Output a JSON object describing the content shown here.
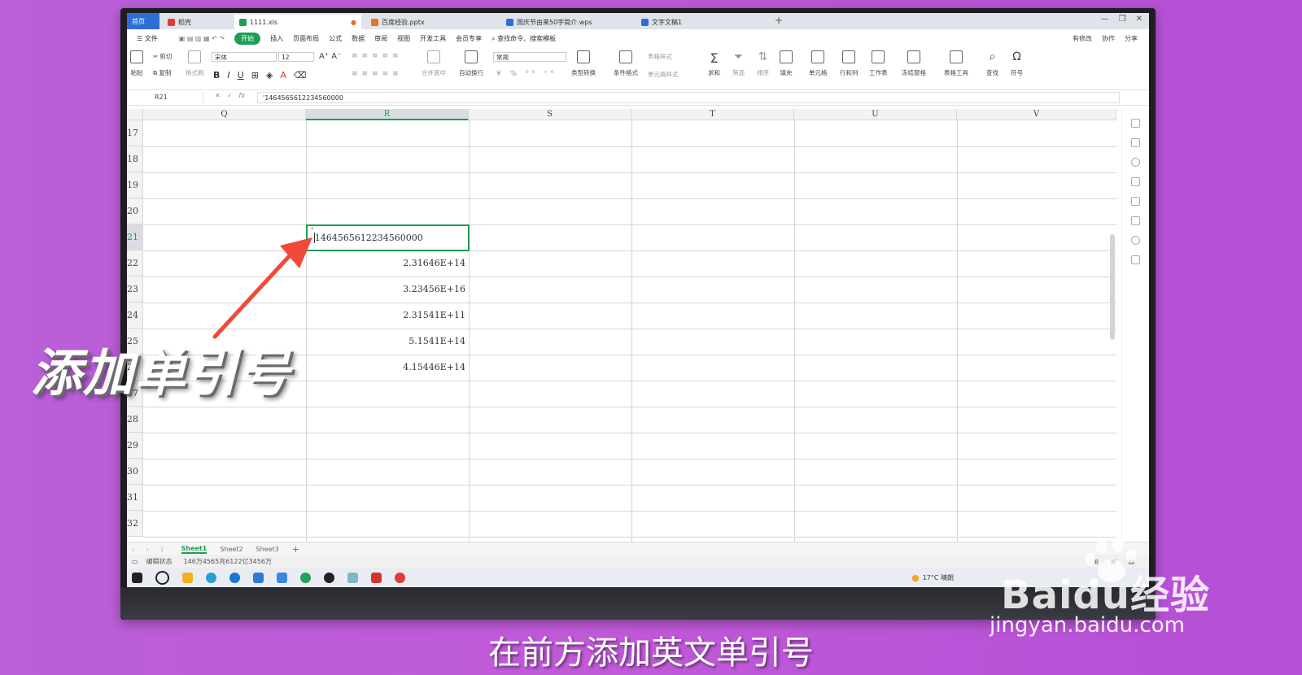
{
  "tabs": [
    {
      "label": "首页",
      "type": "home"
    },
    {
      "label": "稻壳",
      "type": "normal",
      "color": "#e53935"
    },
    {
      "label": "1111.xls",
      "type": "active",
      "color": "#1f9d55"
    },
    {
      "label": "百度经验.pptx",
      "type": "normal",
      "color": "#e8702a"
    },
    {
      "label": "国庆节由来50字简介.wps",
      "type": "normal",
      "color": "#2e6dd6"
    },
    {
      "label": "文字文稿1",
      "type": "normal",
      "color": "#2e6dd6"
    }
  ],
  "menu": {
    "file": "文件",
    "items": [
      "开始",
      "插入",
      "页面布局",
      "公式",
      "数据",
      "审阅",
      "视图",
      "开发工具",
      "会员专享"
    ],
    "search": "查找命令、搜索模板",
    "right": [
      "有修改",
      "协作",
      "分享"
    ]
  },
  "ribbon": {
    "paste": "粘贴",
    "cut": "剪切",
    "copy": "复制",
    "format_painter": "格式刷",
    "font_name": "宋体",
    "font_size": "12",
    "merge": "合并居中",
    "wrap": "自动换行",
    "number_format": "常规",
    "type_convert": "类型转换",
    "cond_format": "条件格式",
    "table_style": "表格样式",
    "cell_style": "单元格样式",
    "sum": "求和",
    "filter": "筛选",
    "sort": "排序",
    "fill": "填充",
    "cell": "单元格",
    "row_col": "行和列",
    "worksheet": "工作表",
    "freeze": "冻结窗格",
    "table_tools": "表格工具",
    "find": "查找",
    "symbol": "符号"
  },
  "formula_bar": {
    "name_box": "R21",
    "fx": "fx",
    "value": "'1464565612234560000"
  },
  "sheet": {
    "columns": [
      "Q",
      "R",
      "S",
      "T",
      "U",
      "V"
    ],
    "selected_column": "R",
    "rows": [
      "17",
      "18",
      "19",
      "20",
      "21",
      "22",
      "23",
      "24",
      "25",
      "26",
      "27",
      "28",
      "29",
      "30",
      "31",
      "32"
    ],
    "selected_row": "21",
    "cells": {
      "r21": "1464565612234560000",
      "r21_quote": "'",
      "r22": "2.31646E+14",
      "r23": "3.23456E+16",
      "r24": "2.31541E+11",
      "r25": "5.1541E+14",
      "r26": "4.15446E+14"
    }
  },
  "sheet_tabs": [
    "Sheet1",
    "Sheet2",
    "Sheet3"
  ],
  "status": {
    "mode": "编辑状态",
    "value": "146万4565兆6122亿3456万"
  },
  "taskbar": {
    "weather": "17°C 晴朗"
  },
  "overlay": {
    "callout": "添加单引号",
    "subtitle": "在前方添加英文单引号",
    "watermark_brand": "Baidu经验",
    "watermark_url": "jingyan.baidu.com"
  },
  "colors": {
    "accent": "#1f9d55",
    "arrow": "#ef4a3a",
    "background": "#bd5bd8"
  }
}
